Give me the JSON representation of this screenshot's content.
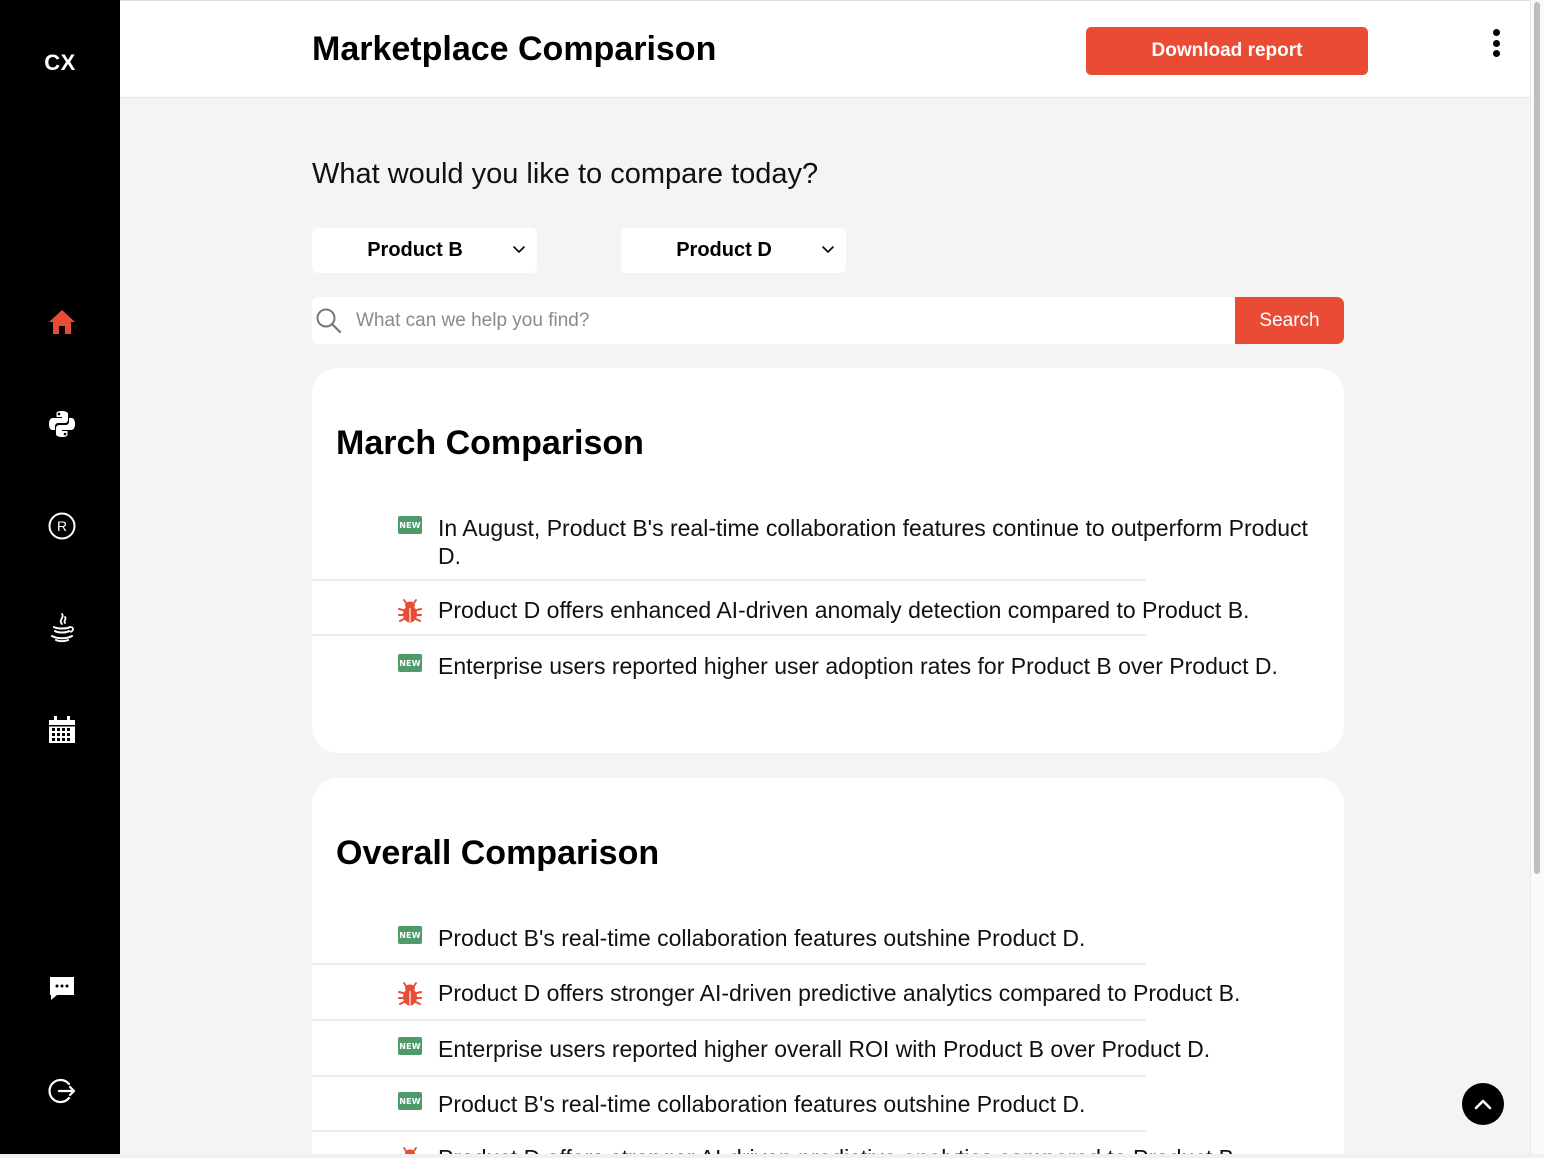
{
  "sidebar": {
    "brand": "CX",
    "items": [
      {
        "id": "home",
        "icon": "home-icon",
        "active": true
      },
      {
        "id": "python",
        "icon": "python-icon"
      },
      {
        "id": "r",
        "icon": "r-icon"
      },
      {
        "id": "java",
        "icon": "java-icon"
      },
      {
        "id": "calendar",
        "icon": "calendar-icon"
      },
      {
        "id": "chat",
        "icon": "chat-icon"
      },
      {
        "id": "logout",
        "icon": "logout-icon"
      }
    ]
  },
  "header": {
    "title": "Marketplace Comparison",
    "download_label": "Download report",
    "menu_icon": "more-vertical-icon"
  },
  "compare": {
    "prompt": "What would you like to compare today?",
    "product_a": "Product B",
    "product_b": "Product D"
  },
  "search": {
    "placeholder": "What can we help you find?",
    "button_label": "Search"
  },
  "sections": [
    {
      "title": "March Comparison",
      "items": [
        {
          "type": "new",
          "text": "In August, Product B's real-time collaboration features continue to outperform Product D."
        },
        {
          "type": "bug",
          "text": "Product D offers enhanced AI-driven anomaly detection compared to Product B."
        },
        {
          "type": "new",
          "text": "Enterprise users reported higher user adoption rates for Product B over Product D."
        }
      ]
    },
    {
      "title": "Overall Comparison",
      "items": [
        {
          "type": "new",
          "text": "Product B's real-time collaboration features outshine Product D."
        },
        {
          "type": "bug",
          "text": "Product D offers stronger AI-driven predictive analytics compared to Product B."
        },
        {
          "type": "new",
          "text": "Enterprise users reported higher overall ROI with Product B over Product D."
        },
        {
          "type": "new",
          "text": "Product B's real-time collaboration features outshine Product D."
        },
        {
          "type": "bug",
          "text": "Product D offers stronger AI-driven predictive analytics compared to Product B."
        }
      ]
    }
  ],
  "badge_new_text": "NEW",
  "colors": {
    "accent": "#e94b35",
    "sidebar": "#000000",
    "new_badge": "#4e9a6a",
    "bug_icon": "#e94b35",
    "background": "#f5f4f2"
  },
  "scroll_top_icon": "chevron-up-icon"
}
